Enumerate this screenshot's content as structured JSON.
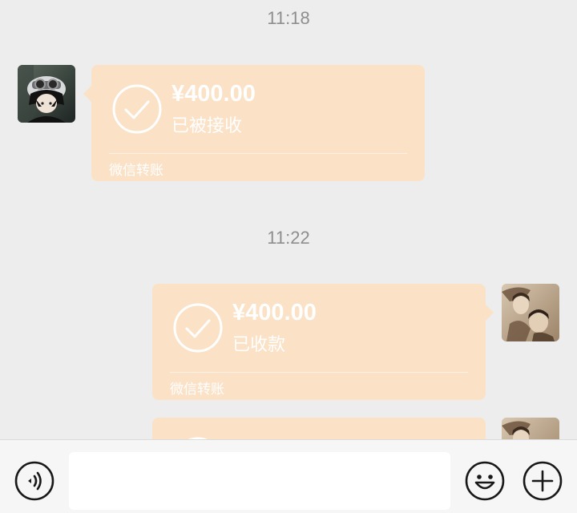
{
  "messages": [
    {
      "time": "11:18",
      "amount": "¥400.00",
      "status": "已被接收",
      "footer": "微信转账"
    },
    {
      "time": "11:22",
      "amount": "¥400.00",
      "status": "已收款",
      "footer": "微信转账"
    }
  ],
  "colors": {
    "background": "#ededed",
    "transfer_bubble": "#fbe1c6",
    "timestamp": "#8e8e8e"
  },
  "input_bar": {
    "voice_icon": "voice-icon",
    "emoji_icon": "emoji-icon",
    "more_icon": "plus-icon",
    "text_value": ""
  }
}
